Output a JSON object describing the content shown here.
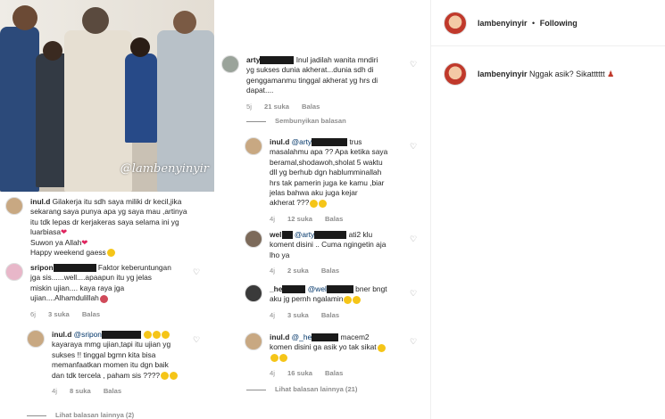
{
  "photo": {
    "watermark": "@lambenyinyir"
  },
  "post": {
    "username": "lambenyinyir",
    "separator": "•",
    "follow_label": "Following",
    "caption_username": "lambenyinyir",
    "caption_text": "Nggak asik? Sikatttttt"
  },
  "left_comments": [
    {
      "username": "inul.d",
      "lines": [
        "Gilakerja itu sdh saya miliki dr kecil,jika",
        "sekarang saya punya apa yg saya mau ,artinya",
        "itu tdk lepas dr kerjakeras saya selama ini yg",
        "luarbiasa",
        "Suwon ya Allah",
        "Happy weekend gaess"
      ]
    },
    {
      "username": "sripon",
      "lines": [
        "Faktor keberuntungan",
        "jga sis......well....apaapun itu yg jelas",
        "miskin ujian.... kaya raya jga",
        "ujian....Alhamdulillah"
      ],
      "time": "6j",
      "likes": "3 suka",
      "reply": "Balas"
    },
    {
      "username": "inul.d",
      "mention": "@sripon",
      "lines": [
        "kayaraya mmg ujian,tapi itu ujian yg",
        "sukses !! tinggal bgmn kita bisa",
        "memanfaatkan momen itu dgn baik",
        "dan tdk tercela , paham sis ????"
      ],
      "time": "4j",
      "likes": "8 suka",
      "reply": "Balas"
    }
  ],
  "left_more": "Lihat balasan lainnya (2)",
  "mid_comments": [
    {
      "username": "arty",
      "lines": [
        "Inul jadilah wanita mndiri",
        "yg sukses dunia akherat...dunia sdh di",
        "genggamanmu tinggal akherat yg hrs di",
        "dapat...."
      ],
      "time": "5j",
      "likes": "21 suka",
      "reply": "Balas"
    },
    {
      "username": "inul.d",
      "mention": "@arty",
      "lines": [
        "trus",
        "masalahmu apa ?? Apa ketika saya",
        "beramal,shodawoh,sholat 5 waktu",
        "dll yg berhub dgn hablumminallah",
        "hrs tak pamerin juga ke kamu ,biar",
        "jelas bahwa aku juga kejar",
        "akherat ???"
      ],
      "time": "4j",
      "likes": "12 suka",
      "reply": "Balas"
    },
    {
      "username": "wel",
      "mention": "@arty",
      "lines": [
        "ati2 klu",
        "koment disini .. Cuma ngingetin aja",
        "lho ya"
      ],
      "time": "4j",
      "likes": "2 suka",
      "reply": "Balas"
    },
    {
      "username": "_he",
      "mention": "@wel",
      "lines": [
        "bner bngt",
        "aku jg pernh ngalamin"
      ],
      "time": "4j",
      "likes": "3 suka",
      "reply": "Balas"
    },
    {
      "username": "inul.d",
      "mention": "@_he",
      "lines": [
        "macem2",
        "komen disini ga asik yo tak sikat"
      ],
      "time": "4j",
      "likes": "16 suka",
      "reply": "Balas"
    }
  ],
  "mid_hide": "Sembunyikan balasan",
  "mid_more": "Lihat balasan lainnya (21)",
  "colors": {
    "meta_gray": "#8e8e8e",
    "text": "#262626",
    "heart_red": "#e0245e"
  }
}
